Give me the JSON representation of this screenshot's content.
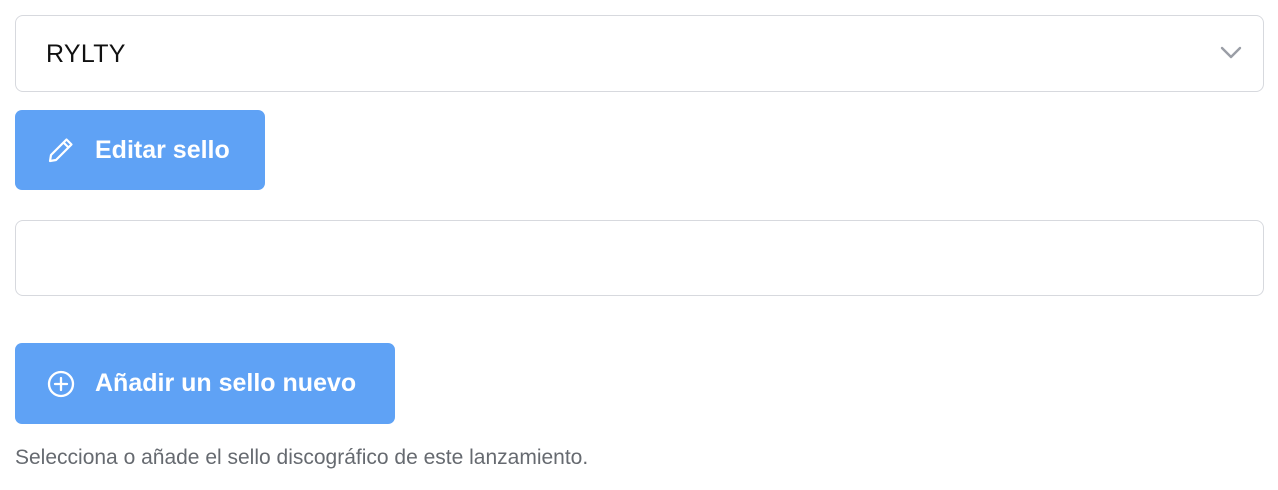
{
  "label_select": {
    "selected_value": "RYLTY",
    "icon": "chevron-down-icon"
  },
  "edit_button": {
    "label": "Editar sello",
    "icon": "pencil-icon"
  },
  "new_label_input": {
    "value": "",
    "placeholder": ""
  },
  "add_button": {
    "label": "Añadir un sello nuevo",
    "icon": "plus-circle-icon"
  },
  "helper_text": "Selecciona o añade el sello discográfico de este lanzamiento.",
  "colors": {
    "button_bg": "#5fa2f5",
    "border": "#d7d9de",
    "helper_text": "#666a70"
  }
}
